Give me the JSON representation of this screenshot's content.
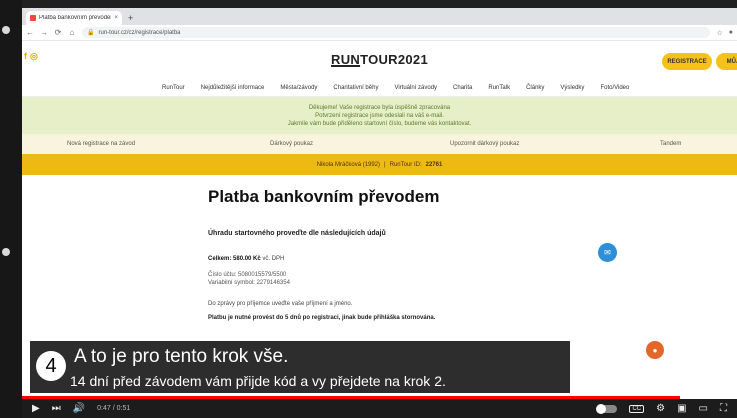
{
  "browser": {
    "tab_title": "Platba bankovním převodem - F",
    "tab_close": "×",
    "new_tab": "+",
    "url": "run-tour.cz/cz/registrace/platba",
    "icons": [
      "back-icon",
      "forward-icon",
      "reload-icon",
      "home-icon",
      "lock-icon",
      "star-icon"
    ]
  },
  "site": {
    "logo_part1": "RUN",
    "logo_part2": "TOUR2021",
    "register_label": "REGISTRACE",
    "myzone_label": "MŮJ Ú",
    "social_icons": [
      "facebook-icon",
      "instagram-icon"
    ],
    "nav": [
      "RunTour",
      "Nejdůležitější informace",
      "Města/závody",
      "Charitativní běhy",
      "Virtuální závody",
      "Charita",
      "RunTalk",
      "Články",
      "Výsledky",
      "Foto/Video"
    ]
  },
  "notice": {
    "line1": "Děkujeme! Vaše registrace byla úspěšně zpracována",
    "line2": "Potvrzení registrace jsme odeslali na váš e-mail.",
    "line3": "Jakmile vám bude přiděleno startovní číslo, budeme vás kontaktovat."
  },
  "steps": [
    "Nová registrace na závod",
    "Dárkový poukaz",
    "Upozornit dárkový poukaz",
    "Tandem"
  ],
  "userbar": {
    "name": "Nikola Mráčková (1992)",
    "separator": "|",
    "id_label": "RunTour ID:",
    "id_value": "22761"
  },
  "content": {
    "title": "Platba bankovním převodem",
    "subtitle": "Úhradu startovného proveďte dle následujících údajů",
    "total_label": "Celkem:",
    "total_value": "580.00 Kč",
    "total_suffix": "vč. DPH",
    "account_line": "Číslo účtu: 5080015579/5500",
    "vs_line": "Variabilní symbol: 2279146354",
    "message_line": "Do zprávy pro příjemce uveďte vaše příjmení a jméno.",
    "must_line": "Platbu je nutné provést do 5 dnů po registraci, jinak bude přihláška stornována."
  },
  "subtitle_overlay": {
    "step_number": "4",
    "line1": "A to je pro tento krok vše.",
    "line2": "14 dní před závodem vám přijde kód a vy přejdete na krok 2."
  },
  "video": {
    "time": "0:47 / 0:51",
    "progress": 0.92,
    "cc_label": "CC",
    "icons": [
      "play-icon",
      "next-icon",
      "volume-icon",
      "autoplay-toggle",
      "subtitles-icon",
      "settings-icon",
      "miniplayer-icon",
      "theater-icon",
      "fullscreen-icon"
    ]
  }
}
